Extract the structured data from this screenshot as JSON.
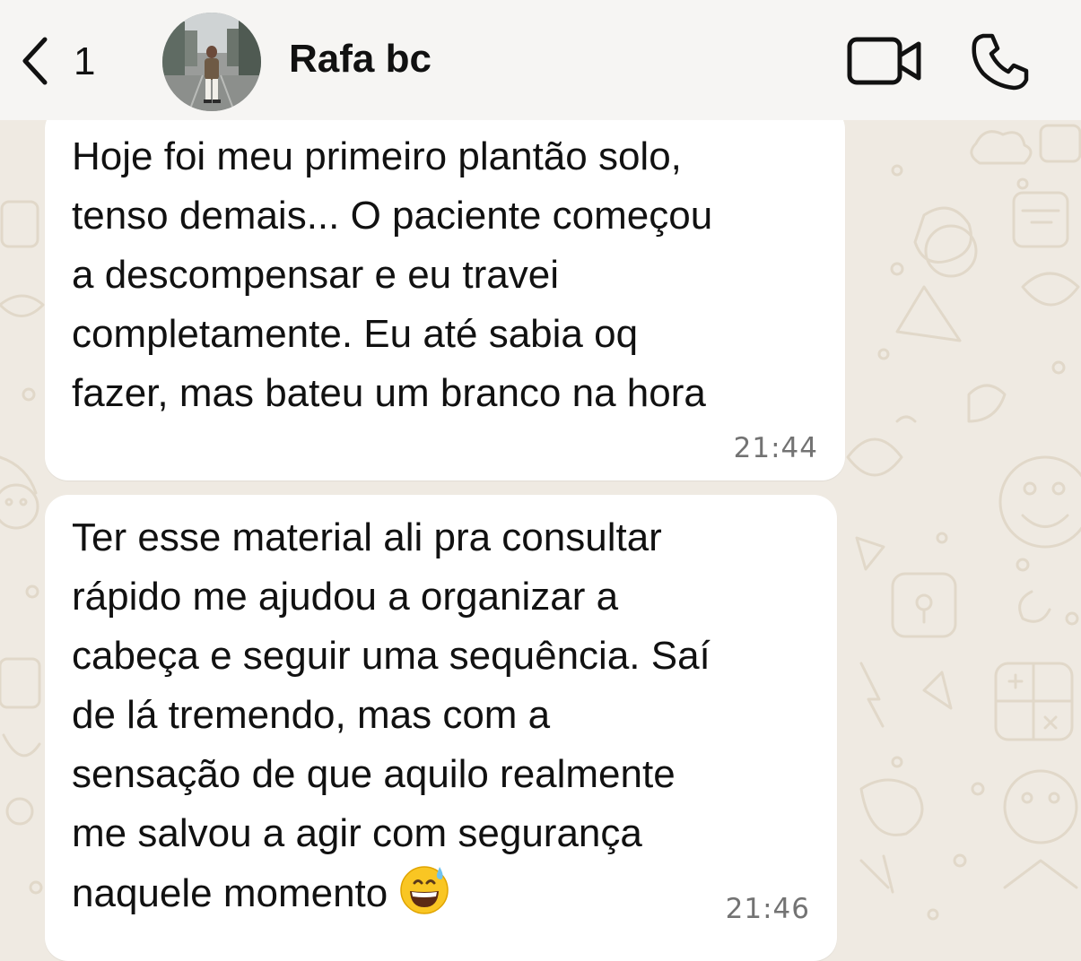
{
  "header": {
    "back_count": "1",
    "contact_name": "Rafa bc",
    "back_icon": "chevron-left-icon",
    "video_icon": "video-camera-icon",
    "call_icon": "phone-icon"
  },
  "messages": [
    {
      "text": "Hoje foi meu primeiro plantão solo,\ntenso demais... O paciente começou\na descompensar e eu travei\ncompletamente. Eu até sabia oq\nfazer, mas bateu um branco na hora",
      "time": "21:44"
    },
    {
      "text": "Ter esse material ali pra consultar\nrápido me ajudou a organizar a\ncabeça e seguir uma sequência. Saí\nde lá tremendo, mas com a\nsensação de que aquilo realmente\nme salvou a agir com segurança\nnaquele momento",
      "emoji": "grinning-face-with-sweat-emoji",
      "time": "21:46"
    }
  ],
  "colors": {
    "background": "#efeae2",
    "header_background": "#f6f5f3",
    "bubble_background": "#ffffff",
    "text": "#111111",
    "timestamp": "#737373"
  }
}
